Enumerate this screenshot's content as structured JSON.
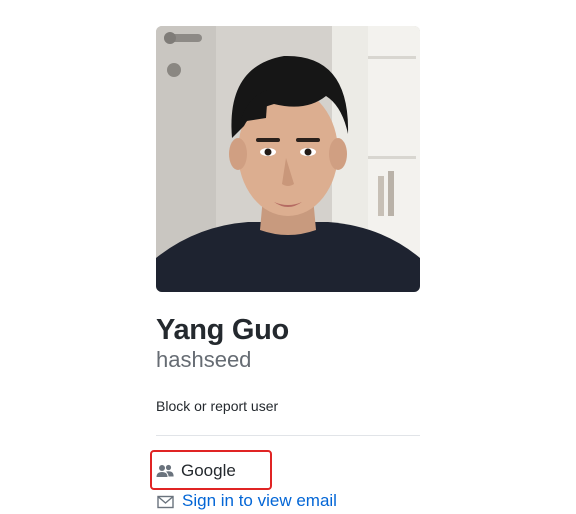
{
  "profile": {
    "full_name": "Yang Guo",
    "username": "hashseed",
    "avatar_icon": "profile-photo"
  },
  "actions": {
    "block_report_label": "Block or report user"
  },
  "details": {
    "organization": "Google",
    "organization_icon": "people-icon",
    "email_link": "Sign in to view email",
    "email_icon": "mail-icon"
  },
  "colors": {
    "link": "#0366d6",
    "highlight": "#e02424",
    "text": "#24292e",
    "muted": "#666c73"
  }
}
